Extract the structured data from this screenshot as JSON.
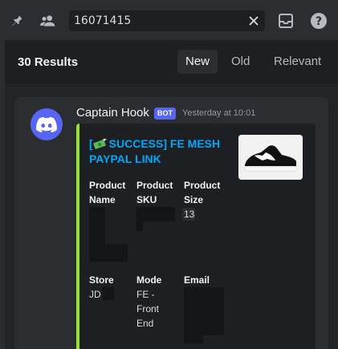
{
  "toolbar": {
    "search_query": "16071415",
    "icons": [
      "pin-icon",
      "members-icon",
      "clear-icon",
      "inbox-icon",
      "help-icon"
    ]
  },
  "results": {
    "count_label": "30 Results",
    "sort_tabs": [
      {
        "label": "New",
        "active": true
      },
      {
        "label": "Old",
        "active": false
      },
      {
        "label": "Relevant",
        "active": false
      }
    ]
  },
  "message": {
    "author": "Captain Hook",
    "badge": "BOT",
    "timestamp": "Yesterday at 10:01",
    "embed": {
      "accent_color": "#93e32f",
      "title": "[💸 SUCCESS] FE MESH PAYPAL LINK",
      "title_prefix": "[",
      "title_text": "SUCCESS] FE MESH PAYPAL LINK",
      "fields": [
        {
          "name_line1": "Product",
          "name_line2": "Name",
          "value": ""
        },
        {
          "name_line1": "Product",
          "name_line2": "SKU",
          "value": ""
        },
        {
          "name_line1": "Product",
          "name_line2": "Size",
          "value": "13"
        },
        {
          "name_line1": "Store",
          "name_line2": "",
          "value": "JD"
        },
        {
          "name_line1": "Mode",
          "name_line2": "",
          "value_line1": "FE -",
          "value_line2": "Front",
          "value_line3": "End"
        },
        {
          "name_line1": "Email",
          "name_line2": "",
          "value": ""
        }
      ]
    }
  },
  "colors": {
    "brand": "#5865f2",
    "link": "#00a8fc",
    "background": "#1e1f22"
  }
}
